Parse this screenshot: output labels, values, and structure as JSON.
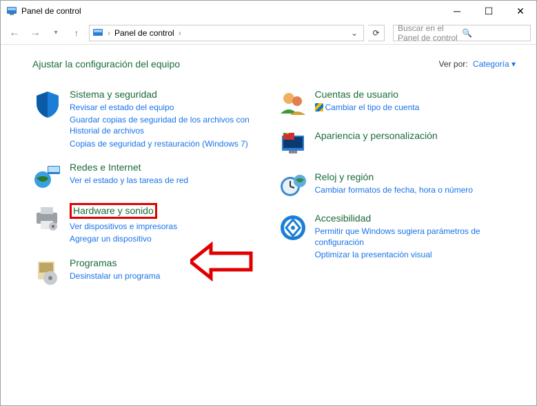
{
  "window": {
    "title": "Panel de control"
  },
  "nav": {
    "breadcrumb": "Panel de control",
    "search_placeholder": "Buscar en el Panel de control"
  },
  "header": {
    "title": "Ajustar la configuración del equipo",
    "viewby_label": "Ver por:",
    "viewby_value": "Categoría"
  },
  "left": {
    "sys": {
      "title": "Sistema y seguridad",
      "l1": "Revisar el estado del equipo",
      "l2": "Guardar copias de seguridad de los archivos con Historial de archivos",
      "l3": "Copias de seguridad y restauración (Windows 7)"
    },
    "net": {
      "title": "Redes e Internet",
      "l1": "Ver el estado y las tareas de red"
    },
    "hw": {
      "title": "Hardware y sonido",
      "l1": "Ver dispositivos e impresoras",
      "l2": "Agregar un dispositivo"
    },
    "prog": {
      "title": "Programas",
      "l1": "Desinstalar un programa"
    }
  },
  "right": {
    "user": {
      "title": "Cuentas de usuario",
      "l1": "Cambiar el tipo de cuenta"
    },
    "app": {
      "title": "Apariencia y personalización"
    },
    "clk": {
      "title": "Reloj y región",
      "l1": "Cambiar formatos de fecha, hora o número"
    },
    "acc": {
      "title": "Accesibilidad",
      "l1": "Permitir que Windows sugiera parámetros de configuración",
      "l2": "Optimizar la presentación visual"
    }
  }
}
